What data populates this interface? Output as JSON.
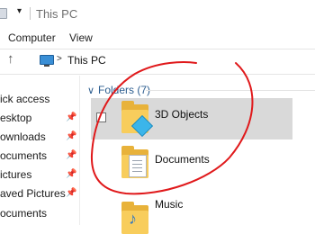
{
  "window": {
    "title": "This PC",
    "qa_dropdown": "▾"
  },
  "ribbon": {
    "tabs": [
      {
        "label": "Computer"
      },
      {
        "label": "View"
      }
    ]
  },
  "address": {
    "up_icon": "up-arrow-icon",
    "chevron": ">",
    "path": "This PC"
  },
  "nav": {
    "items": [
      {
        "label": "ick access",
        "pinned": false
      },
      {
        "label": "esktop",
        "pinned": true
      },
      {
        "label": "ownloads",
        "pinned": true
      },
      {
        "label": "ocuments",
        "pinned": true
      },
      {
        "label": "ictures",
        "pinned": true
      },
      {
        "label": "aved Pictures",
        "pinned": true
      },
      {
        "label": "ocuments",
        "pinned": false
      }
    ]
  },
  "content": {
    "group_header": "Folders (7)",
    "items": [
      {
        "label": "3D Objects",
        "icon": "3d-objects-folder-icon",
        "selected": true
      },
      {
        "label": "Documents",
        "icon": "documents-folder-icon",
        "selected": false
      },
      {
        "label": "Music",
        "icon": "music-folder-icon",
        "selected": false
      }
    ]
  },
  "annotation": {
    "color": "#e0191b",
    "shape": "freehand-circle"
  },
  "colors": {
    "accent": "#2c5d8f",
    "selection": "#d9d9d9",
    "folder": "#f8cd5c"
  }
}
